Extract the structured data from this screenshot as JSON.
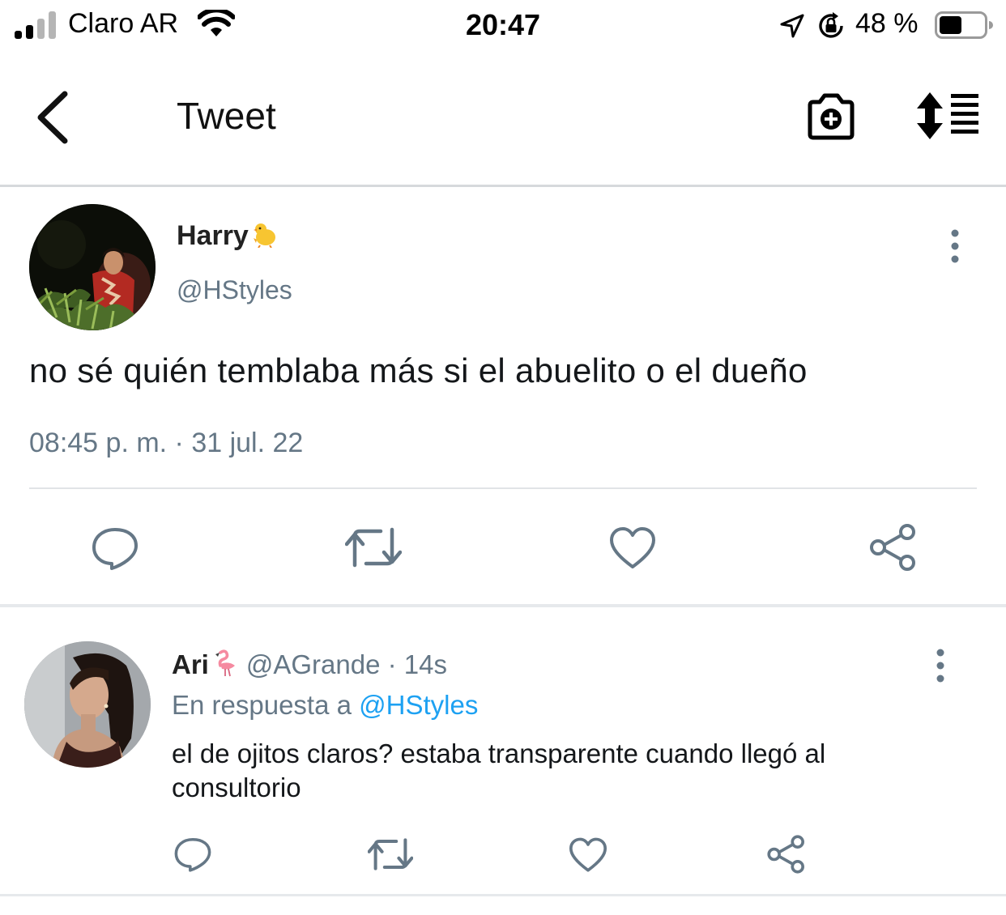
{
  "status_bar": {
    "carrier": "Claro AR",
    "time": "20:47",
    "battery": "48 %",
    "battery_level": 0.48,
    "icons": [
      "signal-icon",
      "wifi-icon",
      "location-arrow-icon",
      "orientation-lock-icon",
      "battery-icon"
    ]
  },
  "nav": {
    "title": "Tweet",
    "icons": [
      "back-chevron-icon",
      "camera-add-icon",
      "sort-list-icon"
    ]
  },
  "tweet": {
    "name": "Harry",
    "name_emoji": "chick-emoji",
    "handle": "@HStyles",
    "text": "no sé quién temblaba más si el abuelito o el dueño",
    "timestamp": "08:45 p. m. · 31 jul. 22",
    "actions": [
      "reply-icon",
      "retweet-icon",
      "like-icon",
      "share-icon"
    ]
  },
  "reply": {
    "name": "Ari",
    "name_emoji": "flamingo-emoji",
    "handle": "@AGrande",
    "age": "· 14s",
    "in_reply_prefix": "En respuesta a",
    "in_reply_handle": "@HStyles",
    "text": "el de ojitos claros? estaba transparente cuando llegó al consultorio",
    "actions": [
      "reply-icon",
      "retweet-icon",
      "like-icon",
      "share-icon"
    ]
  },
  "colors": {
    "text": "#14171a",
    "secondary": "#657786",
    "link": "#1da1f2",
    "divider": "#e1e4e7"
  }
}
